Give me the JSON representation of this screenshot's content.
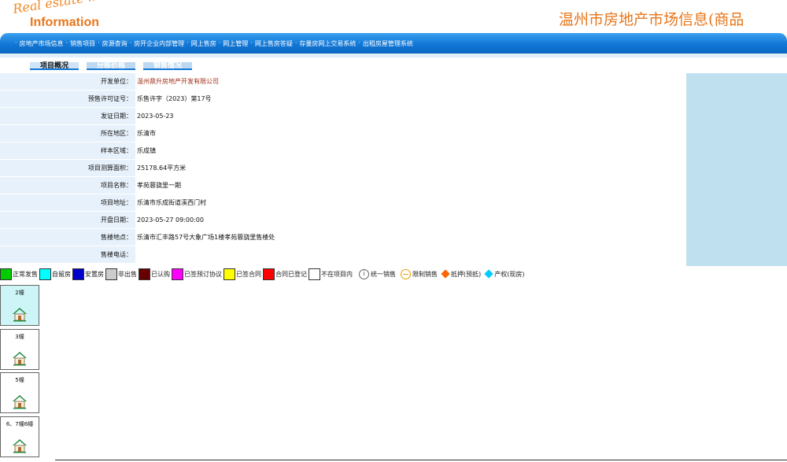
{
  "header": {
    "logo_top": "Real estate market",
    "logo_bottom": "Information",
    "site_title": "温州市房地产市场信息(商品"
  },
  "nav": {
    "items": [
      "房地产市场信息",
      "销售项目",
      "房源查询",
      "房开企业内部管理",
      "网上售房",
      "网上管理",
      "网上售房答疑",
      "存量房网上交易系统",
      "出租房屋管理系统"
    ]
  },
  "tabs": [
    "项目概况",
    "分栋价格",
    "销售情况"
  ],
  "info": [
    {
      "label": "开发单位：",
      "value": "温州鼎升房地产开发有限公司"
    },
    {
      "label": "预售许可证号：",
      "value": "乐售许字（2023）第17号"
    },
    {
      "label": "发证日期：",
      "value": "2023-05-23"
    },
    {
      "label": "所在地区：",
      "value": "乐清市"
    },
    {
      "label": "样本区域：",
      "value": "乐成镇"
    },
    {
      "label": "项目测算面积：",
      "value": "25178.64平方米"
    },
    {
      "label": "项目名称：",
      "value": "孝苑蓉骁里一期"
    },
    {
      "label": "项目地址：",
      "value": "乐清市乐成街道溪西门村"
    },
    {
      "label": "开盘日期：",
      "value": "2023-05-27 09:00:00"
    },
    {
      "label": "售楼地点：",
      "value": "乐清市汇丰路57号大象广场1楼孝苑蓉骁里售楼处"
    },
    {
      "label": "售楼电话：",
      "value": ""
    }
  ],
  "legend": [
    {
      "label": "正常发售",
      "color": "#00cc00"
    },
    {
      "label": "自留房",
      "color": "#00ffff"
    },
    {
      "label": "安置房",
      "color": "#0000cc"
    },
    {
      "label": "非出售",
      "color": "#cccccc"
    },
    {
      "label": "已认购",
      "color": "#660000"
    },
    {
      "label": "已签预订协议",
      "color": "#ff00ff"
    },
    {
      "label": "已签合同",
      "color": "#ffff00"
    },
    {
      "label": "合同已登记",
      "color": "#ff0000"
    },
    {
      "label": "不在项目内",
      "color": "#ffffff"
    }
  ],
  "legend_icons": [
    {
      "label": "统一销售",
      "icon": "info-circle-icon"
    },
    {
      "label": "限制销售",
      "icon": "minus-circle-icon"
    },
    {
      "label": "抵押(预抵)",
      "icon": "orange-diamond-icon",
      "color": "#ff6600"
    },
    {
      "label": "产权(现房)",
      "icon": "cyan-diamond-icon",
      "color": "#00ccff"
    }
  ],
  "buildings": [
    "2幢",
    "3幢",
    "5幢",
    "6、7幢6幢"
  ]
}
